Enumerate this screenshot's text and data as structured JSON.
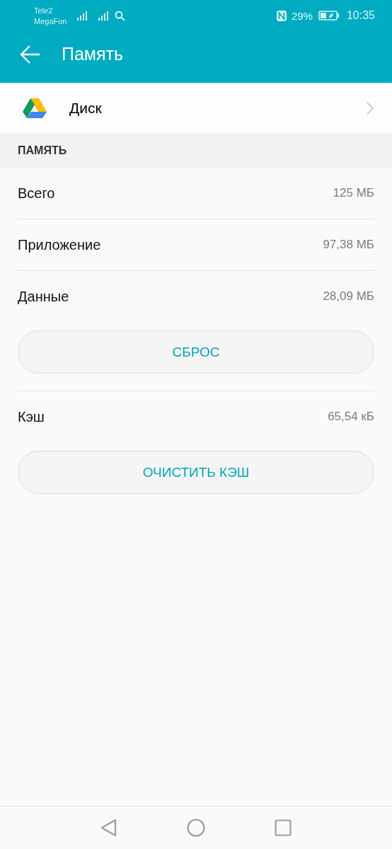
{
  "status_bar": {
    "carriers": [
      "Tele2",
      "MegaFon"
    ],
    "battery": "29%",
    "time": "10:35"
  },
  "header": {
    "title": "Память"
  },
  "app": {
    "name": "Диск"
  },
  "section": {
    "title": "ПАМЯТЬ"
  },
  "items": [
    {
      "kind": "stat",
      "label": "Всего",
      "value": "125 МБ"
    },
    {
      "kind": "stat",
      "label": "Приложение",
      "value": "97,38 МБ"
    },
    {
      "kind": "stat",
      "label": "Данные",
      "value": "28,09 МБ"
    },
    {
      "kind": "button",
      "label": "СБРОС"
    },
    {
      "kind": "stat",
      "label": "Кэш",
      "value": "65,54 кБ"
    },
    {
      "kind": "button",
      "label": "ОЧИСТИТЬ КЭШ"
    }
  ]
}
